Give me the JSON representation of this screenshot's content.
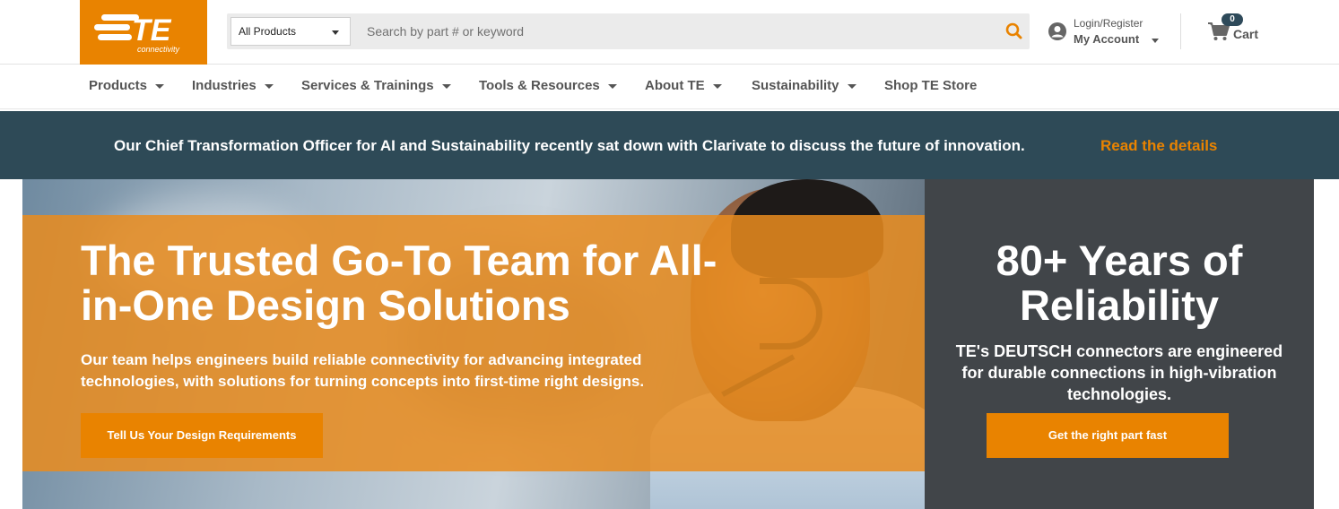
{
  "brand": {
    "name": "TE",
    "tagline": "connectivity",
    "accent_color": "#e98300",
    "dark_color": "#2e4a57"
  },
  "header": {
    "search": {
      "category_selected": "All Products",
      "placeholder": "Search by part # or keyword",
      "icon": "search-icon"
    },
    "account": {
      "top_label": "Login/Register",
      "main_label": "My Account",
      "icon": "user-circle-icon"
    },
    "cart": {
      "label": "Cart",
      "count": "0",
      "icon": "shopping-cart-icon"
    }
  },
  "nav": {
    "items": [
      {
        "label": "Products",
        "dropdown": true
      },
      {
        "label": "Industries",
        "dropdown": true
      },
      {
        "label": "Services & Trainings",
        "dropdown": true
      },
      {
        "label": "Tools & Resources",
        "dropdown": true
      },
      {
        "label": "About TE",
        "dropdown": true
      },
      {
        "label": "Sustainability",
        "dropdown": true
      },
      {
        "label": "Shop TE Store",
        "dropdown": false
      }
    ]
  },
  "announcement": {
    "message": "Our Chief Transformation Officer for AI and Sustainability recently sat down with Clarivate to discuss the future of innovation.",
    "link_text": "Read the details"
  },
  "hero": {
    "title": "The Trusted Go-To Team for All-in-One Design Solutions",
    "subtitle": "Our team helps engineers build reliable connectivity for advancing integrated technologies, with solutions for turning concepts into first-time right designs.",
    "button_label": "Tell Us Your Design Requirements"
  },
  "side_panel": {
    "title": "80+ Years of Reliability",
    "subtitle": "TE's DEUTSCH connectors are engineered for durable connections in high-vibration technologies.",
    "button_label": "Get the right part fast"
  }
}
